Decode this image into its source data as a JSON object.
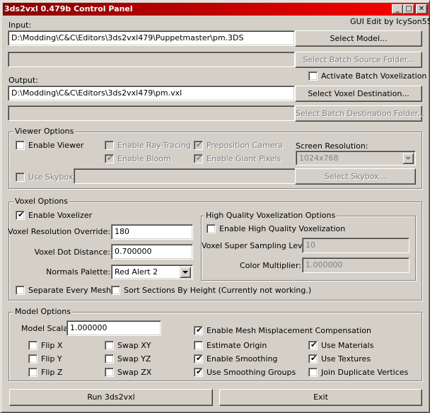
{
  "window": {
    "title": "3ds2vxl 0.479b Control Panel",
    "credit": "GUI Edit by IcySon55",
    "title_gradient": [
      "#8b0000",
      "#ff0000"
    ],
    "controls": {
      "minimize": "_",
      "maximize": "□",
      "close": "✕"
    }
  },
  "io": {
    "input_label": "Input:",
    "input_value": "D:\\Modding\\C&C\\Editors\\3ds2vxl479\\Puppetmaster\\pm.3DS",
    "select_model": "Select Model...",
    "batch_source_value": "",
    "select_batch_source": "Select Batch Source Folder...",
    "activate_batch": {
      "label": "Activate Batch Voxelization",
      "checked": false
    },
    "output_label": "Output:",
    "output_value": "D:\\Modding\\C&C\\Editors\\3ds2vxl479\\pm.vxl",
    "select_voxel_dest": "Select Voxel Destination...",
    "batch_dest_value": "",
    "select_batch_dest": "Select Batch Destination Folder..."
  },
  "viewer": {
    "title": "Viewer Options",
    "enable_viewer": {
      "label": "Enable Viewer",
      "checked": false
    },
    "ray_tracing": {
      "label": "Enable Ray-Tracing",
      "checked": false
    },
    "preposition_camera": {
      "label": "Preposition Camera",
      "checked": true
    },
    "bloom": {
      "label": "Enable Bloom",
      "checked": true
    },
    "giant_pixels": {
      "label": "Enable Giant Pixels",
      "checked": true
    },
    "resolution_label": "Screen Resolution:",
    "resolution_value": "1024x768",
    "use_skybox": {
      "label": "Use Skybox:",
      "checked": false
    },
    "skybox_value": "",
    "select_skybox": "Select Skybox..."
  },
  "voxel": {
    "title": "Voxel Options",
    "enable_voxelizer": {
      "label": "Enable Voxelizer",
      "checked": true
    },
    "resolution_label": "Voxel Resolution Override:",
    "resolution_value": "180",
    "dot_distance_label": "Voxel Dot Distance:",
    "dot_distance_value": "0.700000",
    "palette_label": "Normals Palette:",
    "palette_value": "Red Alert 2",
    "separate_mesh": {
      "label": "Separate Every Mesh",
      "checked": false
    },
    "sort_sections": {
      "label": "Sort Sections By Height (Currently not working.)",
      "checked": false
    },
    "hq": {
      "title": "High Quality Voxelization Options",
      "enable": {
        "label": "Enable High Quality Voxelization",
        "checked": false
      },
      "super_sampling_label": "Voxel Super Sampling Level:",
      "super_sampling_value": "10",
      "color_mult_label": "Color Multiplier:",
      "color_mult_value": "1.000000"
    }
  },
  "model": {
    "title": "Model Options",
    "scalar_label": "Model Scalar:",
    "scalar_value": "1.000000",
    "flip_x": {
      "label": "Flip X",
      "checked": false
    },
    "flip_y": {
      "label": "Flip Y",
      "checked": false
    },
    "flip_z": {
      "label": "Flip Z",
      "checked": false
    },
    "swap_xy": {
      "label": "Swap XY",
      "checked": false
    },
    "swap_yz": {
      "label": "Swap YZ",
      "checked": false
    },
    "swap_zx": {
      "label": "Swap ZX",
      "checked": false
    },
    "mesh_misplacement": {
      "label": "Enable Mesh Misplacement Compensation",
      "checked": true
    },
    "estimate_origin": {
      "label": "Estimate Origin",
      "checked": false
    },
    "enable_smoothing": {
      "label": "Enable Smoothing",
      "checked": true
    },
    "smoothing_groups": {
      "label": "Use Smoothing Groups",
      "checked": true
    },
    "use_materials": {
      "label": "Use Materials",
      "checked": true
    },
    "use_textures": {
      "label": "Use Textures",
      "checked": true
    },
    "join_vertices": {
      "label": "Join Duplicate Vertices",
      "checked": false
    }
  },
  "actions": {
    "run": "Run 3ds2vxl",
    "exit": "Exit"
  }
}
